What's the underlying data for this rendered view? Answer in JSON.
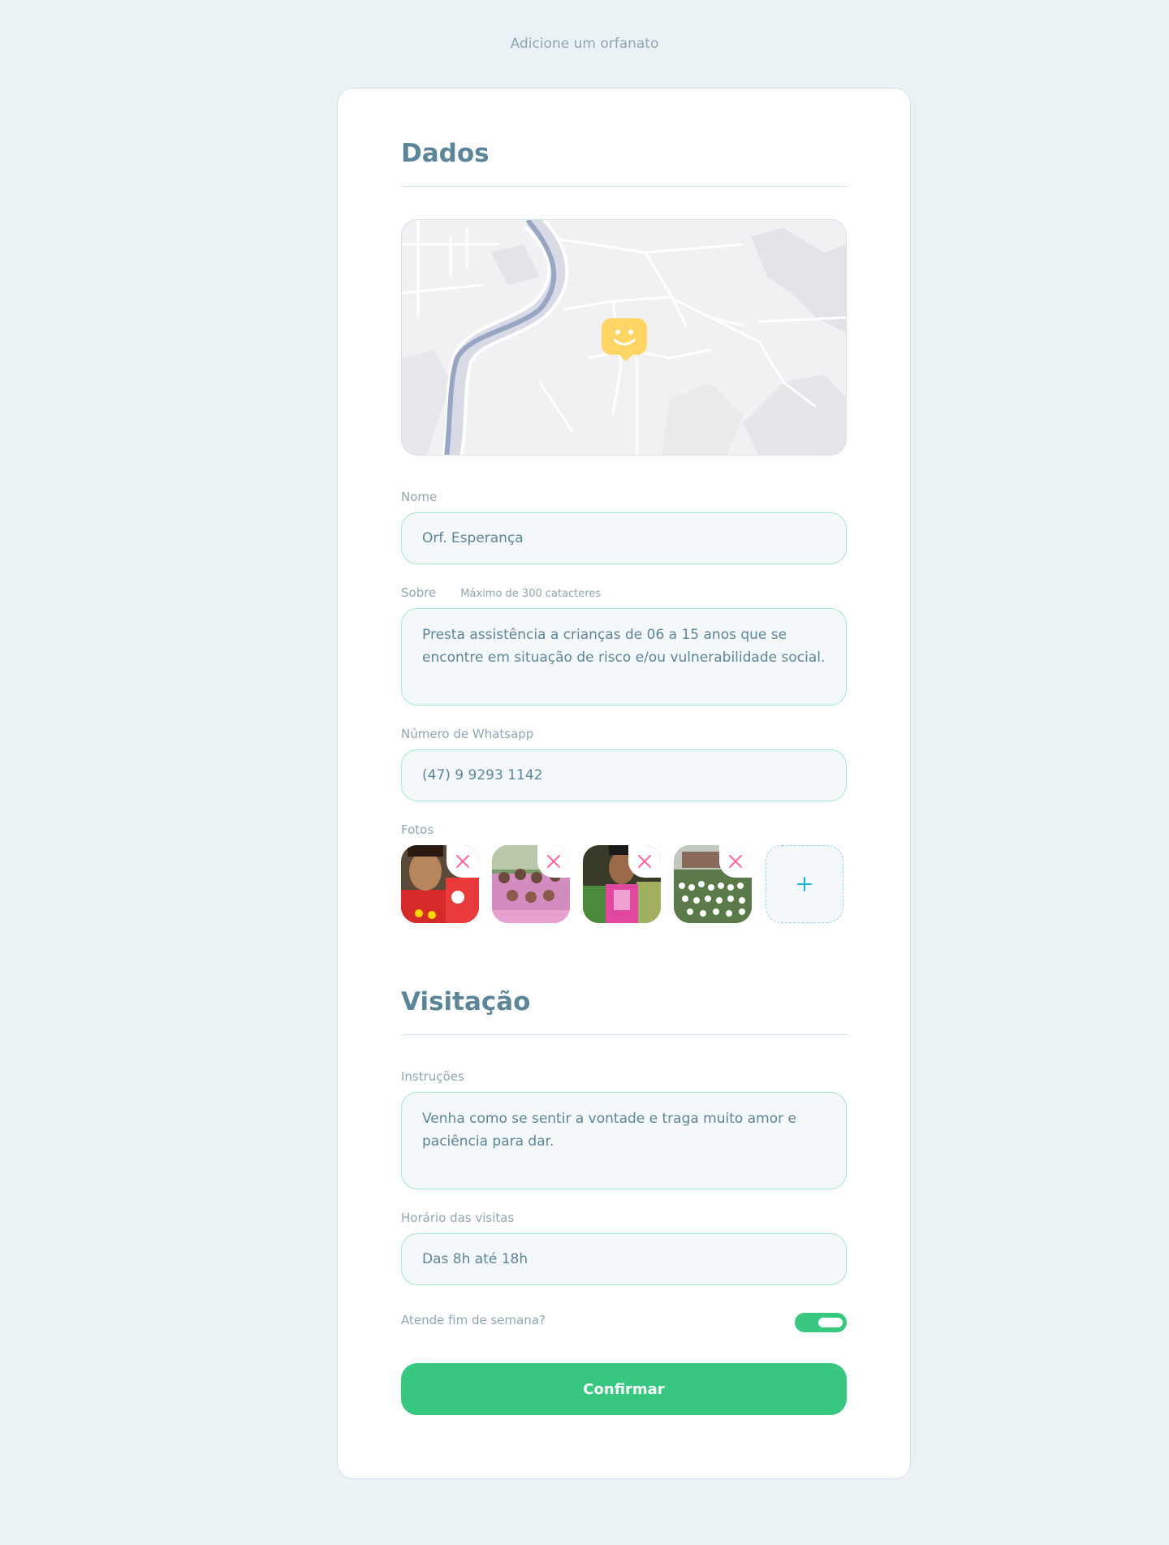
{
  "header": {
    "title": "Adicione um orfanato"
  },
  "dados": {
    "title": "Dados",
    "map": {
      "marker_icon": "happy-face-marker-icon",
      "marker_color": "#ffd666"
    },
    "nome": {
      "label": "Nome",
      "value": "Orf. Esperança"
    },
    "sobre": {
      "label": "Sobre",
      "hint": "Máximo de 300 catacteres",
      "value": "Presta assistência a crianças de 06 a 15 anos que se encontre em situação de risco e/ou vulnerabilidade social."
    },
    "whatsapp": {
      "label": "Número de Whatsapp",
      "value": "(47) 9 9293 1142"
    },
    "fotos": {
      "label": "Fotos",
      "count": 4,
      "remove_icon": "close-icon",
      "add_icon": "plus-icon"
    }
  },
  "visitacao": {
    "title": "Visitação",
    "instrucoes": {
      "label": "Instruções",
      "value": "Venha como se sentir a vontade e traga muito amor e paciência para dar."
    },
    "horario": {
      "label": "Horário das visitas",
      "value": "Das 8h até 18h"
    },
    "fim_de_semana": {
      "label": "Atende fim de semana?",
      "enabled": true
    }
  },
  "confirm_label": "Confirmar",
  "colors": {
    "background": "#ebf2f5",
    "accent": "#37c77f",
    "text": "#5c8599",
    "remove": "#ff669d",
    "add": "#15b6d6"
  }
}
